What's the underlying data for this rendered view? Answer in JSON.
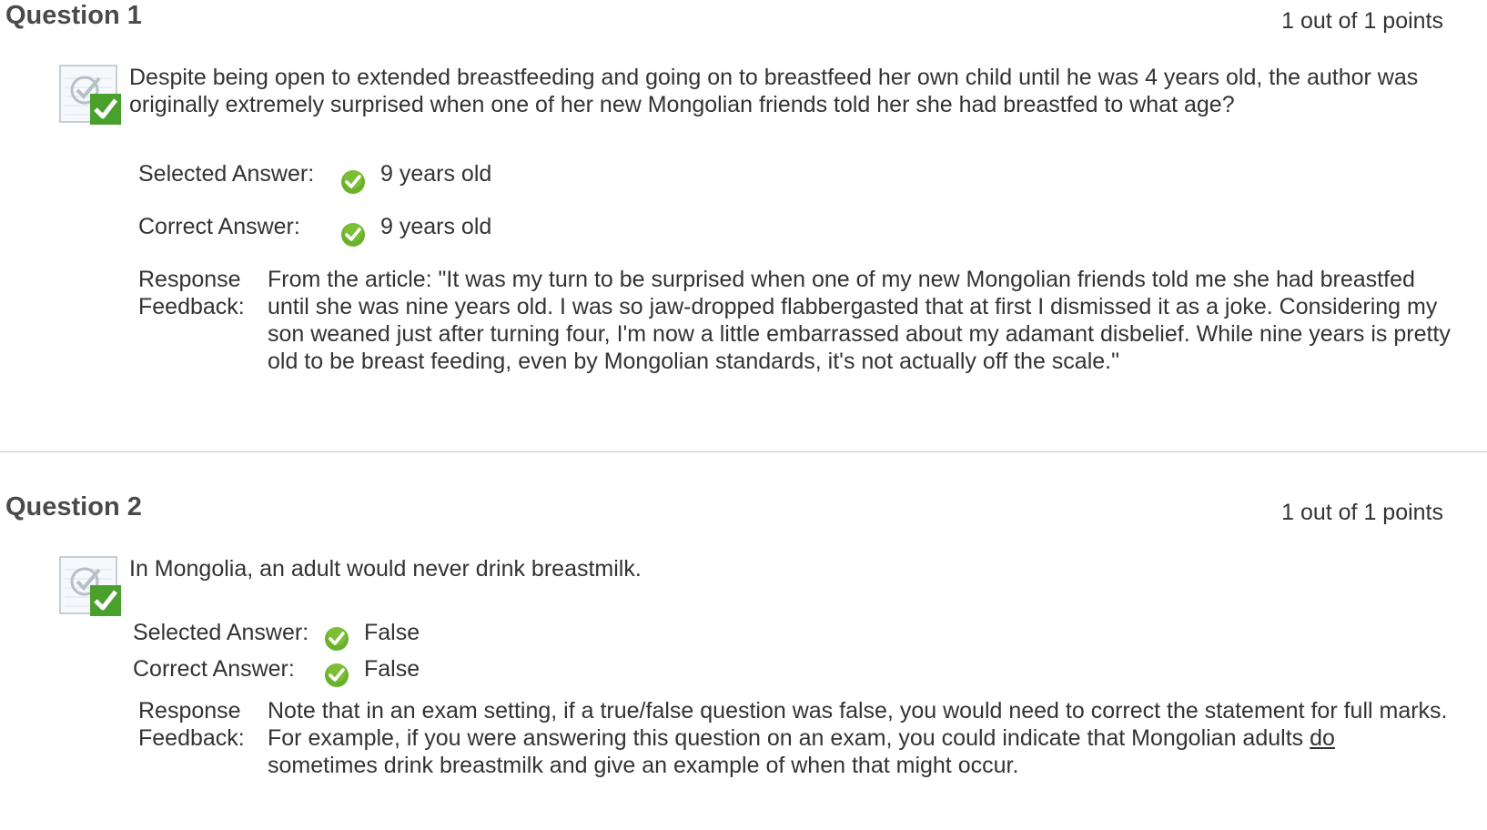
{
  "colors": {
    "check_green": "#5aa51e",
    "divider": "#c9c9c9",
    "text": "#333333",
    "title": "#4a4a4a"
  },
  "questions": [
    {
      "title": "Question 1",
      "points": "1 out of 1 points",
      "status_icon": "graded-correct-icon",
      "text": "Despite being open to extended breastfeeding and going on to breastfeed her own child until he was 4 years old, the author was originally extremely surprised when one of her new Mongolian friends told her she had breastfed to what age?",
      "selected_label": "Selected Answer:",
      "selected_value": "9 years old",
      "correct_label": "Correct Answer:",
      "correct_value": "9 years old",
      "feedback_label_1": "Response",
      "feedback_label_2": "Feedback:",
      "feedback_text": "From the article: \"It was my turn to be surprised when one of my new Mongolian friends told me she had breastfed until she was nine years old. I was so jaw-dropped flabbergasted that at first I dismissed it as a joke. Considering my son weaned just after turning four, I'm now a little embarrassed about my adamant disbelief. While nine years is pretty old to be breast feeding, even by Mongolian standards, it's not actually off the scale.\""
    },
    {
      "title": "Question 2",
      "points": "1 out of 1 points",
      "status_icon": "graded-correct-icon",
      "text": "In Mongolia, an adult would never drink breastmilk.",
      "selected_label": "Selected Answer:",
      "selected_value": "False",
      "correct_label": "Correct Answer:",
      "correct_value": "False",
      "feedback_label_1": "Response",
      "feedback_label_2": "Feedback:",
      "feedback_text_a": "Note that in an exam setting, if a true/false question was false, you would need to correct the statement for full marks.  For example, if you were answering this question on an exam, you could indicate that Mongolian adults ",
      "feedback_text_underlined": "do",
      "feedback_text_b": " sometimes drink breastmilk and give an example of when that might occur."
    }
  ]
}
